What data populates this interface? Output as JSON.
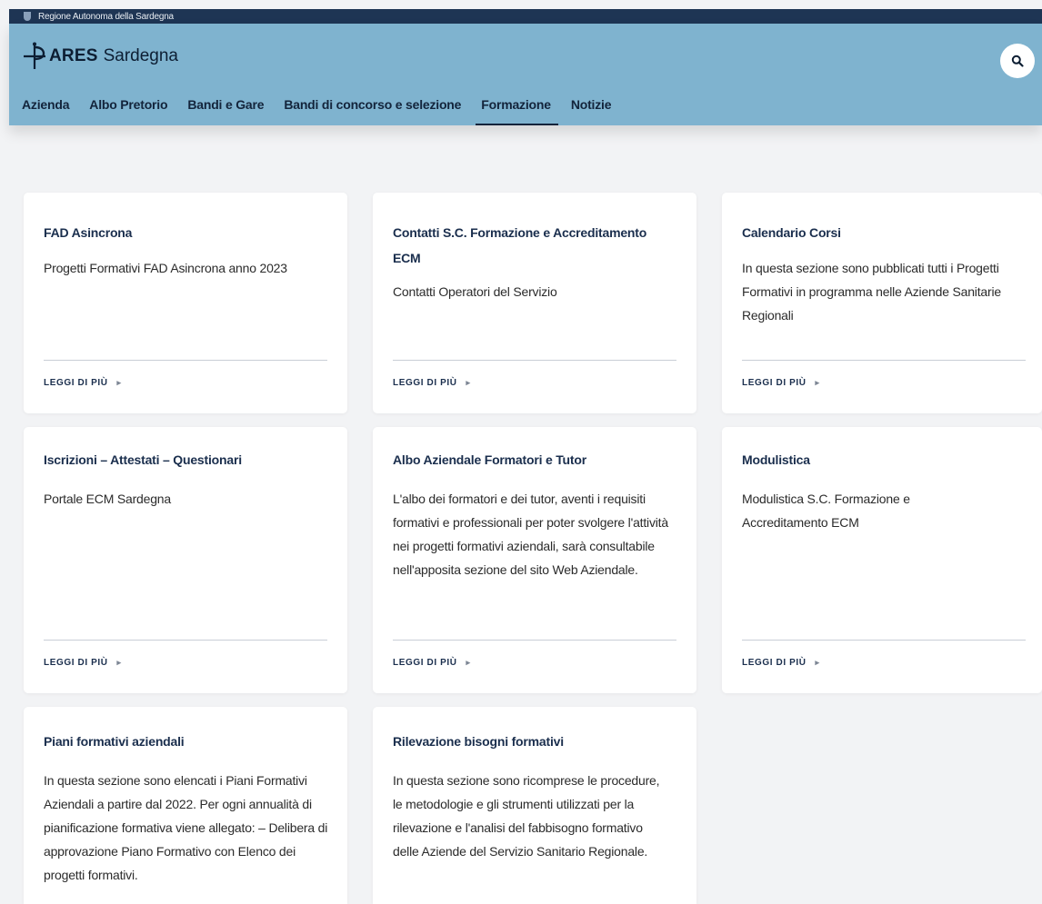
{
  "topbar": {
    "text": "Regione Autonoma della Sardegna"
  },
  "brand": {
    "name_bold": "ARES",
    "name_rest": "Sardegna"
  },
  "nav": [
    {
      "label": "Azienda"
    },
    {
      "label": "Albo Pretorio"
    },
    {
      "label": "Bandi e Gare"
    },
    {
      "label": "Bandi di concorso e selezione"
    },
    {
      "label": "Formazione",
      "active": true
    },
    {
      "label": "Notizie"
    }
  ],
  "colors": {
    "topbar": "#1e3554",
    "header": "#7fb3cf",
    "title": "#1a2e4d",
    "page": "#f2f3f5"
  },
  "icons": {
    "search": "search-icon",
    "logo": "ares-logo-icon",
    "arrow": "arrow-right-icon"
  },
  "cards": [
    {
      "title": "FAD Asincrona",
      "desc": "Progetti Formativi FAD Asincrona anno 2023",
      "more": "LEGGI DI PIÙ"
    },
    {
      "title": "Contatti S.C. Formazione e Accreditamento ECM",
      "desc": "Contatti Operatori del Servizio",
      "more": "LEGGI DI PIÙ"
    },
    {
      "title": "Calendario Corsi",
      "desc": "In questa sezione sono pubblicati tutti i Progetti Formativi in programma nelle Aziende Sanitarie Regionali",
      "more": "LEGGI DI PIÙ"
    },
    {
      "title": "Iscrizioni – Attestati – Questionari",
      "desc": "Portale ECM Sardegna",
      "more": "LEGGI DI PIÙ"
    },
    {
      "title": "Albo Aziendale Formatori e Tutor",
      "desc": "L'albo dei formatori e dei tutor, aventi i requisiti formativi e professionali per poter svolgere l'attività nei progetti formativi aziendali, sarà consultabile nell'apposita sezione del sito Web Aziendale.",
      "more": "LEGGI DI PIÙ"
    },
    {
      "title": "Modulistica",
      "desc": "Modulistica S.C. Formazione e Accreditamento ECM",
      "more": "LEGGI DI PIÙ"
    },
    {
      "title": "Piani formativi aziendali",
      "desc": "In questa sezione sono elencati i Piani Formativi Aziendali a partire dal 2022. Per ogni annualità di pianificazione formativa viene allegato: – Delibera di approvazione Piano Formativo con Elenco dei progetti formativi."
    },
    {
      "title": "Rilevazione bisogni formativi",
      "desc": "In questa sezione sono ricomprese le procedure, le metodologie e gli strumenti utilizzati per la rilevazione e l'analisi del fabbisogno formativo delle Aziende del Servizio Sanitario Regionale."
    }
  ]
}
